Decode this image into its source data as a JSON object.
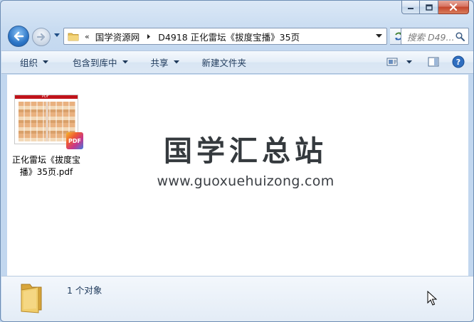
{
  "window": {
    "caption_buttons": [
      "minimize",
      "maximize",
      "close"
    ]
  },
  "nav": {
    "breadcrumb_overflow": "«",
    "breadcrumbs": [
      "国学资源网",
      "D4918 正化雷坛《拔度宝播》35页"
    ],
    "search_placeholder": "搜索 D49..."
  },
  "toolbar": {
    "organize": "组织",
    "include_in_library": "包含到库中",
    "share": "共享",
    "new_folder": "新建文件夹"
  },
  "content": {
    "files": [
      {
        "name": "正化雷坛《拔度宝播》35页.pdf",
        "name_line1": "正化雷坛《拔度宝",
        "name_line2": "播》35页.pdf",
        "thumb_header": "PDF",
        "badge": "PDF"
      }
    ],
    "watermark_title": "国学汇总站",
    "watermark_url": "www.guoxuehuizong.com"
  },
  "details": {
    "count": "1 个对象"
  },
  "colors": {
    "accent": "#1e395b",
    "close_red": "#c4452c",
    "window_frame": "#c2d7ef"
  }
}
